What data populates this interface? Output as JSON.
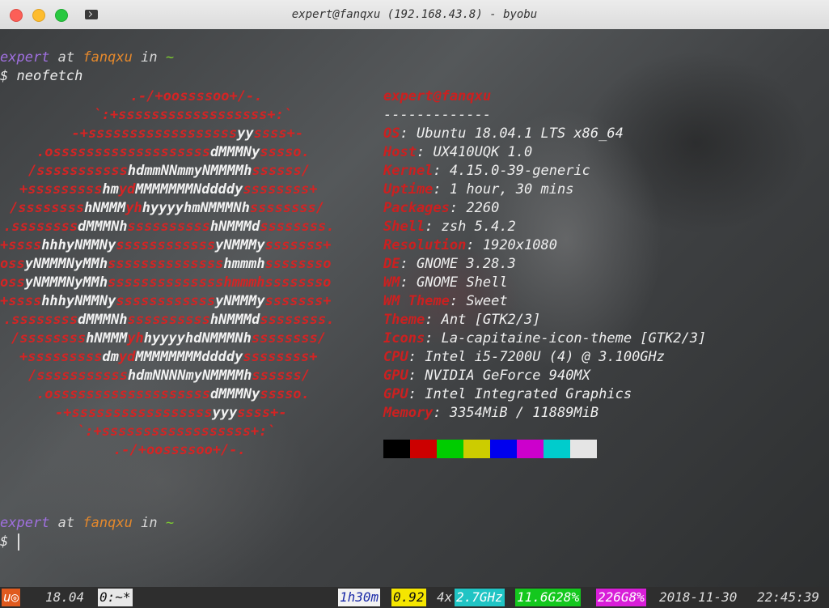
{
  "window": {
    "title": "expert@fanqxu (192.168.43.8) - byobu"
  },
  "prompt": {
    "user": "expert",
    "at": "at",
    "host": "fanqxu",
    "in": "in",
    "dir": "~",
    "symbol": "$",
    "command": "neofetch"
  },
  "ascii_art": [
    [
      [
        "r",
        "   .-/+oossssoo+/-.       "
      ]
    ],
    [
      [
        "r",
        "  `:+ssssssssssssssssss+:`"
      ]
    ],
    [
      [
        "r",
        "  -+ssssssssssssssssss"
      ],
      [
        "w",
        "yy"
      ],
      [
        "r",
        "ssss+-"
      ]
    ],
    [
      [
        "r",
        ".osssssssssssssssssss"
      ],
      [
        "w",
        "dMMMNy"
      ],
      [
        "r",
        "sssso."
      ]
    ],
    [
      [
        "r",
        "/sssssssssss"
      ],
      [
        "w",
        "hdmmNNmmyNMMMMh"
      ],
      [
        "r",
        "ssssss/"
      ]
    ],
    [
      [
        "r",
        "+sssssssss"
      ],
      [
        "w",
        "hm"
      ],
      [
        "r",
        "yd"
      ],
      [
        "w",
        "MMMMMMMNddddy"
      ],
      [
        "r",
        "ssssssss+"
      ]
    ],
    [
      [
        "r",
        "/ssssssss"
      ],
      [
        "w",
        "hNMMM"
      ],
      [
        "r",
        "yh"
      ],
      [
        "w",
        "hyyyyhmNMMMNh"
      ],
      [
        "r",
        "ssssssss/"
      ]
    ],
    [
      [
        "r",
        ".ssssssss"
      ],
      [
        "w",
        "dMMMNh"
      ],
      [
        "r",
        "ssssssssss"
      ],
      [
        "w",
        "hNMMMd"
      ],
      [
        "r",
        "ssssssss."
      ]
    ],
    [
      [
        "r",
        "+ssss"
      ],
      [
        "w",
        "hhhyNMMNy"
      ],
      [
        "r",
        "ssssssssssss"
      ],
      [
        "w",
        "yNMMMy"
      ],
      [
        "r",
        "sssssss+"
      ]
    ],
    [
      [
        "r",
        "oss"
      ],
      [
        "w",
        "yNMMMNyMMh"
      ],
      [
        "r",
        "ssssssssssssss"
      ],
      [
        "w",
        "hmmmh"
      ],
      [
        "r",
        "ssssssso"
      ]
    ],
    [
      [
        "r",
        "oss"
      ],
      [
        "w",
        "yNMMMNyMMh"
      ],
      [
        "r",
        "sssssssssssssshmmmhssssssso"
      ]
    ],
    [
      [
        "r",
        "+ssss"
      ],
      [
        "w",
        "hhhyNMMNy"
      ],
      [
        "r",
        "ssssssssssss"
      ],
      [
        "w",
        "yNMMMy"
      ],
      [
        "r",
        "sssssss+"
      ]
    ],
    [
      [
        "r",
        ".ssssssss"
      ],
      [
        "w",
        "dMMMNh"
      ],
      [
        "r",
        "ssssssssss"
      ],
      [
        "w",
        "hNMMMd"
      ],
      [
        "r",
        "ssssssss."
      ]
    ],
    [
      [
        "r",
        "/ssssssss"
      ],
      [
        "w",
        "hNMMM"
      ],
      [
        "r",
        "yh"
      ],
      [
        "w",
        "hyyyyhdNMMMNh"
      ],
      [
        "r",
        "ssssssss/"
      ]
    ],
    [
      [
        "r",
        "+sssssssss"
      ],
      [
        "w",
        "dm"
      ],
      [
        "r",
        "yd"
      ],
      [
        "w",
        "MMMMMMMMddddy"
      ],
      [
        "r",
        "ssssssss+"
      ]
    ],
    [
      [
        "r",
        "/sssssssssss"
      ],
      [
        "w",
        "hdmNNNNmyNMMMMh"
      ],
      [
        "r",
        "ssssss/"
      ]
    ],
    [
      [
        "r",
        ".osssssssssssssssssss"
      ],
      [
        "w",
        "dMMMNy"
      ],
      [
        "r",
        "sssso."
      ]
    ],
    [
      [
        "r",
        "-+sssssssssssssssss"
      ],
      [
        "w",
        "yyy"
      ],
      [
        "r",
        "ssss+-"
      ]
    ],
    [
      [
        "r",
        "`:+ssssssssssssssssss+:`"
      ]
    ],
    [
      [
        "r",
        ".-/+oossssoo+/-."
      ]
    ]
  ],
  "sysinfo": {
    "header": "expert@fanqxu",
    "separator": "-------------",
    "rows": [
      {
        "key": "OS",
        "value": "Ubuntu 18.04.1 LTS x86_64"
      },
      {
        "key": "Host",
        "value": "UX410UQK 1.0"
      },
      {
        "key": "Kernel",
        "value": "4.15.0-39-generic"
      },
      {
        "key": "Uptime",
        "value": "1 hour, 30 mins"
      },
      {
        "key": "Packages",
        "value": "2260"
      },
      {
        "key": "Shell",
        "value": "zsh 5.4.2"
      },
      {
        "key": "Resolution",
        "value": "1920x1080"
      },
      {
        "key": "DE",
        "value": "GNOME 3.28.3"
      },
      {
        "key": "WM",
        "value": "GNOME Shell"
      },
      {
        "key": "WM Theme",
        "value": "Sweet"
      },
      {
        "key": "Theme",
        "value": "Ant [GTK2/3]"
      },
      {
        "key": "Icons",
        "value": "La-capitaine-icon-theme [GTK2/3]"
      },
      {
        "key": "CPU",
        "value": "Intel i5-7200U (4) @ 3.100GHz"
      },
      {
        "key": "GPU",
        "value": "NVIDIA GeForce 940MX"
      },
      {
        "key": "GPU",
        "value": "Intel Integrated Graphics"
      },
      {
        "key": "Memory",
        "value": "3354MiB / 11889MiB"
      }
    ],
    "palette": [
      "#000000",
      "#cc0000",
      "#00cc00",
      "#cccc00",
      "#0000ee",
      "#cc00cc",
      "#00cccc",
      "#e5e5e5"
    ]
  },
  "status": {
    "os_glyph": "u",
    "version": "18.04",
    "window_tab": "0:~*",
    "uptime": "1h30m",
    "load": "0.92",
    "cpu_count": "4x",
    "cpu_freq": "2.7GHz",
    "mem_total": "11.6G",
    "mem_pct": "28%",
    "disk": "226G",
    "disk_pct": "8%",
    "date": "2018-11-30",
    "time": "22:45:39"
  }
}
